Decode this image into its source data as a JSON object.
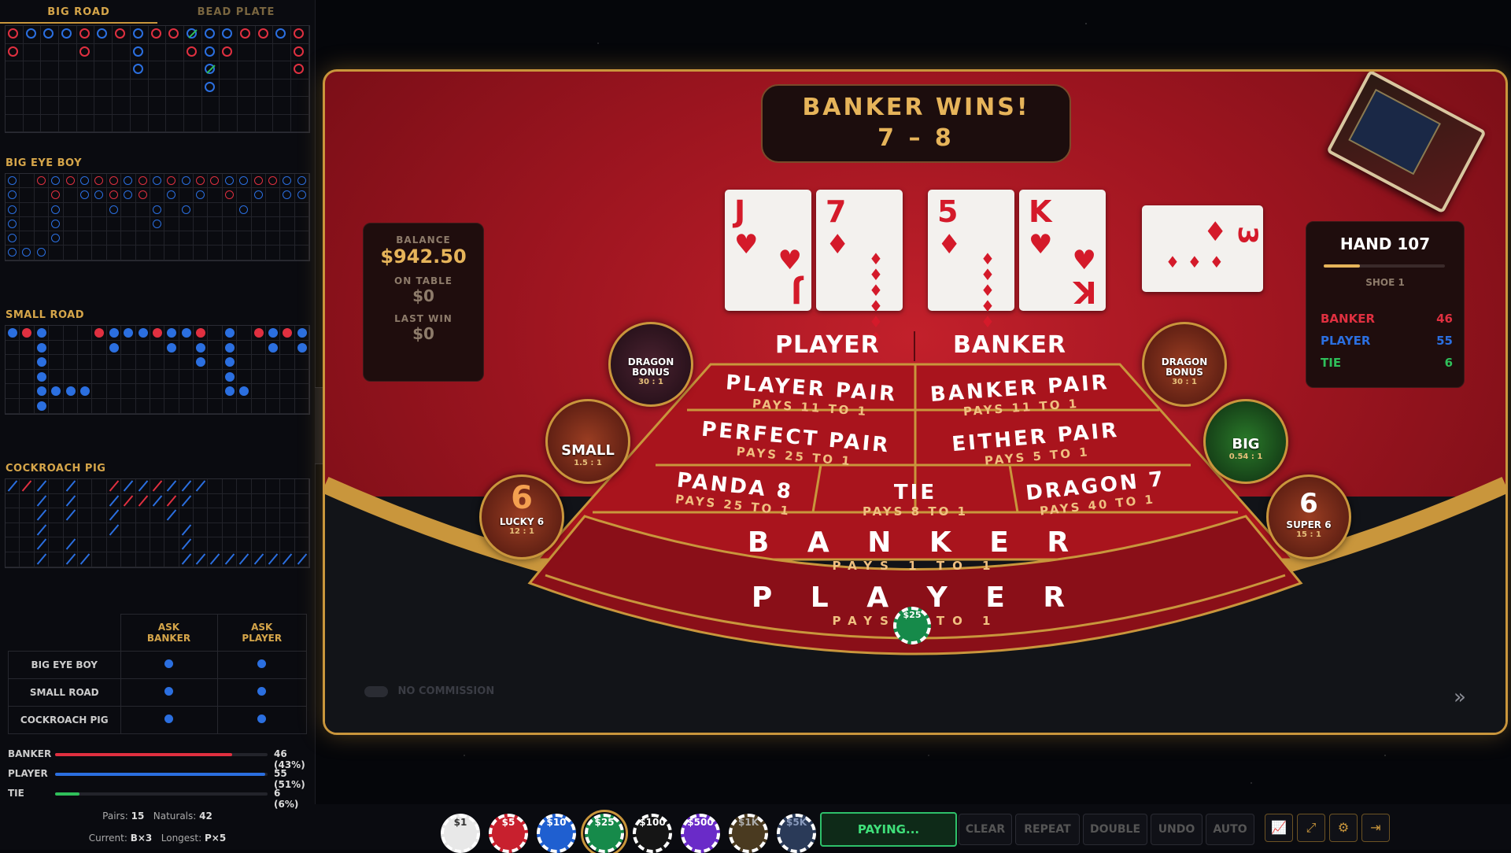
{
  "left": {
    "tabs": [
      "BIG ROAD",
      "BEAD PLATE"
    ],
    "big_eye_label": "BIG EYE BOY",
    "small_road_label": "SMALL ROAD",
    "cockroach_label": "COCKROACH PIG",
    "ask": {
      "headers": [
        "ASK\nBANKER",
        "ASK\nPLAYER"
      ],
      "rows": [
        "BIG EYE BOY",
        "SMALL ROAD",
        "COCKROACH PIG"
      ]
    },
    "stats": [
      {
        "label": "BANKER",
        "value": "46 (43%)",
        "fraction": 0.43,
        "color": "#e03040"
      },
      {
        "label": "PLAYER",
        "value": "55 (51%)",
        "fraction": 0.51,
        "color": "#2b6fe0"
      },
      {
        "label": "TIE",
        "value": "6 (6%)",
        "fraction": 0.06,
        "color": "#2fbf5a"
      }
    ],
    "pairs_label": "Pairs:",
    "pairs_value": "15",
    "naturals_label": "Naturals:",
    "naturals_value": "42",
    "current_label": "Current:",
    "current_value": "B×3",
    "longest_label": "Longest:",
    "longest_value": "P×5"
  },
  "result": {
    "title": "BANKER WINS!",
    "score": "7 – 8"
  },
  "balance": {
    "label": "BALANCE",
    "value": "$942.50",
    "on_table_label": "ON TABLE",
    "on_table": "$0",
    "last_win_label": "LAST WIN",
    "last_win": "$0"
  },
  "cards": {
    "player": [
      {
        "rank": "J",
        "suit": "♥"
      },
      {
        "rank": "7",
        "suit": "♦"
      }
    ],
    "banker": [
      {
        "rank": "5",
        "suit": "♦"
      },
      {
        "rank": "K",
        "suit": "♥"
      }
    ],
    "third": {
      "rank": "3",
      "suit": "♦"
    }
  },
  "hands": {
    "player_label": "PLAYER",
    "player_score": "7",
    "banker_label": "BANKER",
    "banker_score": "8"
  },
  "sidebets": {
    "dragon_left": {
      "name": "DRAGON\nBONUS",
      "pays": "30 : 1"
    },
    "dragon_right": {
      "name": "DRAGON\nBONUS",
      "pays": "30 : 1"
    },
    "small": {
      "name": "SMALL",
      "pays": "1.5 : 1"
    },
    "big": {
      "name": "BIG",
      "pays": "0.54 : 1"
    },
    "lucky6": {
      "name": "LUCKY 6",
      "pays": "12 : 1"
    },
    "super6": {
      "name": "SUPER 6",
      "pays": "15 : 1"
    }
  },
  "bets": {
    "player_pair": {
      "name": "PLAYER PAIR",
      "pays": "PAYS 11 TO 1"
    },
    "banker_pair": {
      "name": "BANKER PAIR",
      "pays": "PAYS 11 TO 1"
    },
    "perfect_pair": {
      "name": "PERFECT PAIR",
      "pays": "PAYS 25 TO 1"
    },
    "either_pair": {
      "name": "EITHER PAIR",
      "pays": "PAYS 5 TO 1"
    },
    "panda8": {
      "name": "PANDA 8",
      "pays": "PAYS 25 TO 1"
    },
    "tie": {
      "name": "TIE",
      "pays": "PAYS 8 TO 1"
    },
    "dragon7": {
      "name": "DRAGON 7",
      "pays": "PAYS 40 TO 1"
    },
    "banker": {
      "name": "B A N K E R",
      "pays": "PAYS 1 TO 1"
    },
    "player": {
      "name": "P L A Y E R",
      "pays": "PAYS 1 TO 1"
    }
  },
  "placed_chip": "$25",
  "no_commission": "NO COMMISSION",
  "hand_panel": {
    "title": "HAND 107",
    "shoe": "SHOE 1",
    "progress": 0.3,
    "rows": [
      {
        "label": "BANKER",
        "value": "46",
        "color": "#e03040"
      },
      {
        "label": "PLAYER",
        "value": "55",
        "color": "#2b6fe0"
      },
      {
        "label": "TIE",
        "value": "6",
        "color": "#2fbf5a"
      }
    ]
  },
  "chips": [
    {
      "label": "$1",
      "color": "#e8e8e8",
      "text": "#333"
    },
    {
      "label": "$5",
      "color": "#c8202e",
      "text": "#fff"
    },
    {
      "label": "$10",
      "color": "#1f5fd0",
      "text": "#fff"
    },
    {
      "label": "$25",
      "color": "#168a4a",
      "text": "#fff"
    },
    {
      "label": "$100",
      "color": "#151515",
      "text": "#fff"
    },
    {
      "label": "$500",
      "color": "#6a2bc8",
      "text": "#fff"
    },
    {
      "label": "$1K",
      "color": "#4a3a20",
      "text": "#aaa"
    },
    {
      "label": "$5K",
      "color": "#2a3a58",
      "text": "#8899bb"
    }
  ],
  "buttons": {
    "paying": "PAYING...",
    "clear": "CLEAR",
    "repeat": "REPEAT",
    "double": "DOUBLE",
    "undo": "UNDO",
    "auto": "AUTO"
  },
  "icons": [
    "chart-icon",
    "fullscreen-icon",
    "gear-icon",
    "exit-icon"
  ]
}
